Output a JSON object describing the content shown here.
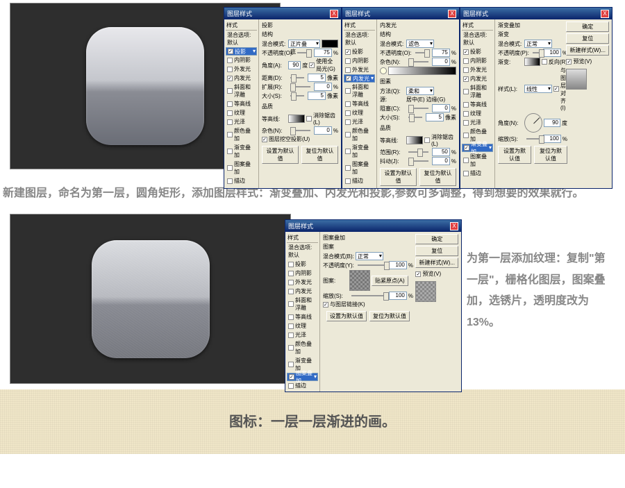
{
  "dialog_title": "图层样式",
  "close_x": "X",
  "side": {
    "header": "样式",
    "blend": "混合选项:默认",
    "drop_shadow": "投影",
    "inner_shadow": "内阴影",
    "outer_glow": "外发光",
    "inner_glow": "内发光",
    "bevel": "斜面和浮雕",
    "contour": "等高线",
    "texture": "纹理",
    "satin": "光泽",
    "color_overlay": "颜色叠加",
    "grad_overlay": "渐变叠加",
    "pattern_overlay": "图案叠加",
    "stroke": "描边"
  },
  "d1": {
    "section": "投影",
    "struct": "结构",
    "blend_mode": "混合模式:",
    "blend_val": "正片叠底",
    "opacity": "不透明度(O):",
    "opacity_val": "75",
    "angle": "角度(A):",
    "angle_val": "90",
    "use_global": "使用全局光(G)",
    "distance": "距离(D):",
    "distance_val": "5",
    "spread": "扩展(R):",
    "spread_val": "0",
    "size": "大小(S):",
    "size_val": "5",
    "quality": "品质",
    "contour": "等高线:",
    "anti": "消除锯齿(L)",
    "noise": "杂色(N):",
    "noise_val": "0",
    "knockout": "图层挖空投影(U)",
    "px": "像素",
    "pct": "%",
    "deg": "度"
  },
  "d2": {
    "section": "内发光",
    "struct": "结构",
    "blend_mode": "混合模式:",
    "blend_val": "滤色",
    "opacity": "不透明度(O):",
    "opacity_val": "75",
    "noise": "杂色(N):",
    "noise_val": "0",
    "elements": "图素",
    "technique": "方法(Q):",
    "technique_val": "柔和",
    "source": "源:",
    "center": "居中(E)",
    "edge": "边缘(G)",
    "choke": "阻塞(C):",
    "choke_val": "0",
    "size": "大小(S):",
    "size_val": "5",
    "quality": "品质",
    "contour": "等高线:",
    "anti": "消除锯齿(L)",
    "range": "范围(R):",
    "range_val": "50",
    "jitter": "抖动(J):",
    "jitter_val": "0"
  },
  "d3": {
    "section": "渐变叠加",
    "grad_grp": "渐变",
    "blend_mode": "混合模式:",
    "blend_val": "正常",
    "opacity": "不透明度(P):",
    "opacity_val": "100",
    "gradient": "渐变:",
    "reverse": "反向(R)",
    "style": "样式(L):",
    "style_val": "线性",
    "align": "与图层对齐(I)",
    "angle": "角度(N):",
    "angle_val": "90",
    "scale": "缩放(S):",
    "scale_val": "100"
  },
  "d4": {
    "section": "图案叠加",
    "grp": "图案",
    "blend_mode": "混合模式(B):",
    "blend_val": "正常",
    "opacity": "不透明度(Y):",
    "opacity_val": "100",
    "pattern": "图案:",
    "snap": "贴紧原点(A)",
    "scale": "缩放(S):",
    "scale_val": "100",
    "link": "与图层链接(K)"
  },
  "buttons": {
    "ok": "确定",
    "cancel": "复位",
    "new": "新建样式(W)...",
    "preview": "预览(V)",
    "default": "设置为默认值",
    "reset": "复位为默认值"
  },
  "caption1": "新建图层，命名为第一层，圆角矩形，添加图层样式：渐变叠加、内发光和投影,参数可多调整，得到想要的效果就行。",
  "caption2": "为第一层添加纹理：复制\"第一层\"，栅格化图层，图案叠加，选锈片，透明度改为13%。",
  "footer": "图标：一层一层渐进的画。"
}
